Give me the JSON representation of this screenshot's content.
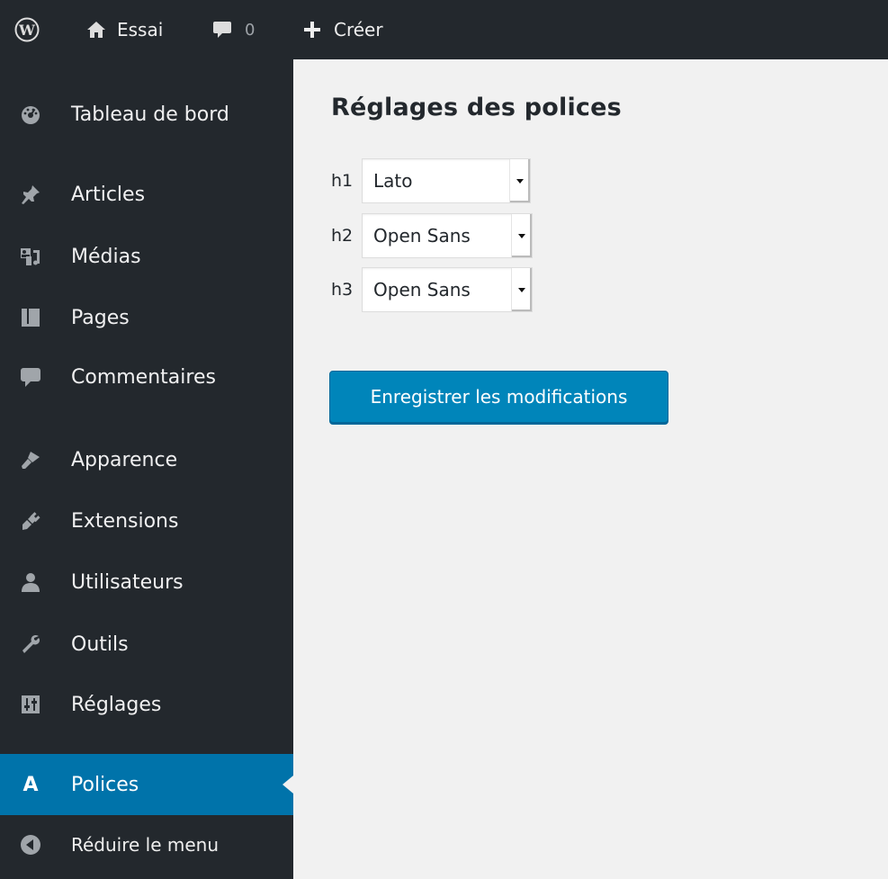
{
  "admin_bar": {
    "site_name": "Essai",
    "comments_count": "0",
    "new_label": "Créer"
  },
  "sidebar": {
    "items": [
      {
        "label": "Tableau de bord",
        "icon": "dashboard-icon"
      },
      {
        "label": "Articles",
        "icon": "pin-icon"
      },
      {
        "label": "Médias",
        "icon": "media-icon"
      },
      {
        "label": "Pages",
        "icon": "pages-icon"
      },
      {
        "label": "Commentaires",
        "icon": "comment-icon"
      },
      {
        "label": "Apparence",
        "icon": "paintbrush-icon"
      },
      {
        "label": "Extensions",
        "icon": "plugin-icon"
      },
      {
        "label": "Utilisateurs",
        "icon": "users-icon"
      },
      {
        "label": "Outils",
        "icon": "wrench-icon"
      },
      {
        "label": "Réglages",
        "icon": "settings-icon"
      },
      {
        "label": "Polices",
        "icon": "font-icon",
        "current": true
      }
    ],
    "collapse_label": "Réduire le menu",
    "font_icon_glyph": "A"
  },
  "main": {
    "title": "Réglages des polices",
    "rows": [
      {
        "label": "h1",
        "value": "Lato"
      },
      {
        "label": "h2",
        "value": "Open Sans"
      },
      {
        "label": "h3",
        "value": "Open Sans"
      }
    ],
    "save_label": "Enregistrer les modifications"
  },
  "colors": {
    "admin_dark": "#23282d",
    "accent": "#0073aa",
    "button": "#0085ba",
    "background": "#f1f1f1"
  }
}
